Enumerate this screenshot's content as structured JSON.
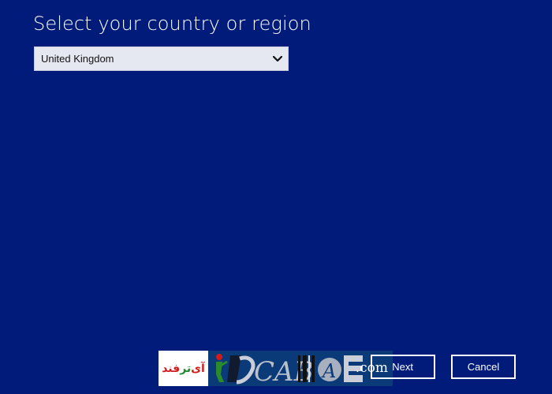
{
  "page": {
    "title": "Select your country or region"
  },
  "country_select": {
    "value": "United Kingdom",
    "icon": "chevron-down-icon"
  },
  "buttons": {
    "next": "Next",
    "cancel": "Cancel"
  },
  "watermark": {
    "farsi_part1": "آی",
    "farsi_part2": "تر",
    "farsi_part3": "فند",
    "logo_letters": "CAB",
    "dotcom": ".com"
  },
  "colors": {
    "background": "#001b79",
    "text": "#ffffff",
    "select_bg": "#e6e8f1"
  }
}
